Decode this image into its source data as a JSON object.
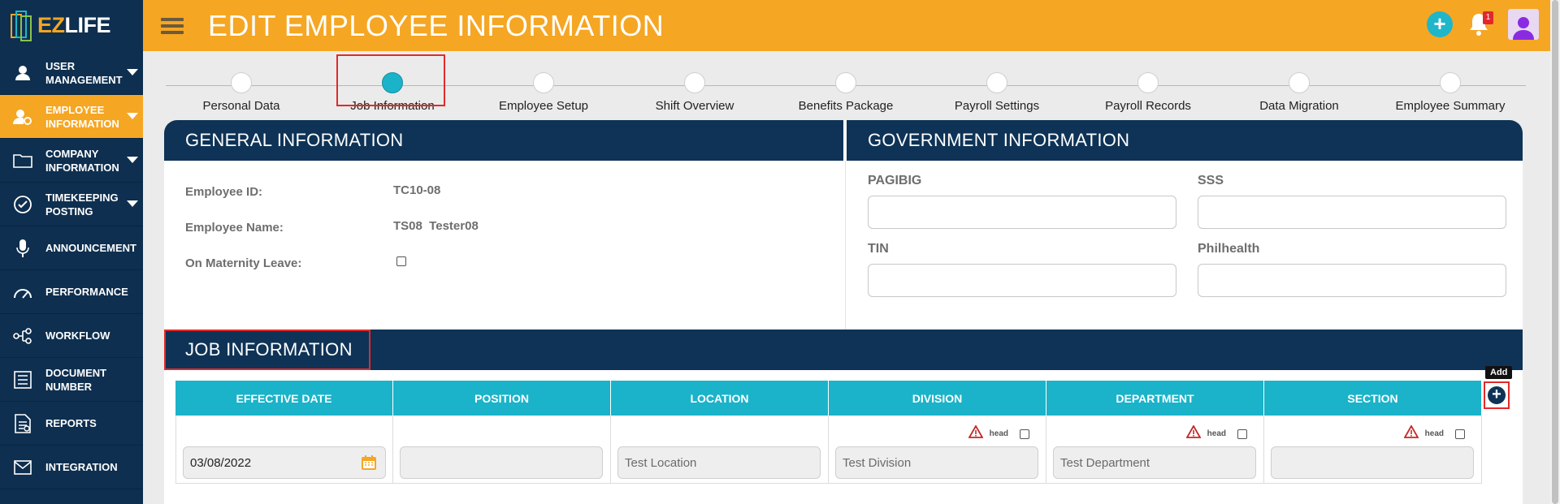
{
  "app": {
    "logo_prefix": "EZ",
    "logo_suffix": "LIFE"
  },
  "header": {
    "title": "EDIT EMPLOYEE INFORMATION",
    "notification_count": "1"
  },
  "sidebar": {
    "items": [
      {
        "label": "USER MANAGEMENT",
        "icon": "user-icon",
        "active": false,
        "has_caret": true
      },
      {
        "label": "EMPLOYEE INFORMATION",
        "icon": "employee-settings-icon",
        "active": true,
        "has_caret": true
      },
      {
        "label": "COMPANY INFORMATION",
        "icon": "folder-icon",
        "active": false,
        "has_caret": true
      },
      {
        "label": "TIMEKEEPING POSTING",
        "icon": "check-circle-icon",
        "active": false,
        "has_caret": true
      },
      {
        "label": "ANNOUNCEMENT",
        "icon": "microphone-icon",
        "active": false,
        "has_caret": false
      },
      {
        "label": "PERFORMANCE",
        "icon": "gauge-icon",
        "active": false,
        "has_caret": false
      },
      {
        "label": "WORKFLOW",
        "icon": "workflow-icon",
        "active": false,
        "has_caret": false
      },
      {
        "label": "DOCUMENT NUMBER",
        "icon": "document-list-icon",
        "active": false,
        "has_caret": false
      },
      {
        "label": "REPORTS",
        "icon": "report-icon",
        "active": false,
        "has_caret": false
      },
      {
        "label": "INTEGRATION",
        "icon": "mail-icon",
        "active": false,
        "has_caret": false
      }
    ]
  },
  "stepper": {
    "steps": [
      {
        "label": "Personal Data"
      },
      {
        "label": "Job Information"
      },
      {
        "label": "Employee Setup"
      },
      {
        "label": "Shift Overview"
      },
      {
        "label": "Benefits Package"
      },
      {
        "label": "Payroll Settings"
      },
      {
        "label": "Payroll Records"
      },
      {
        "label": "Data Migration"
      },
      {
        "label": "Employee Summary"
      }
    ],
    "active_index": 1
  },
  "general": {
    "title": "GENERAL INFORMATION",
    "employee_id_label": "Employee ID:",
    "employee_id": "TC10-08",
    "employee_name_label": "Employee Name:",
    "employee_name": "TS08  Tester08",
    "maternity_label": "On Maternity Leave:"
  },
  "government": {
    "title": "GOVERNMENT INFORMATION",
    "pagibig_label": "PAGIBIG",
    "sss_label": "SSS",
    "tin_label": "TIN",
    "philhealth_label": "Philhealth"
  },
  "job": {
    "title": "JOB INFORMATION",
    "columns": [
      "EFFECTIVE DATE",
      "POSITION",
      "LOCATION",
      "DIVISION",
      "DEPARTMENT",
      "SECTION"
    ],
    "row": {
      "effective_date": "03/08/2022",
      "position": "",
      "location": "Test Location",
      "division": "Test Division",
      "department": "Test Department",
      "section": ""
    },
    "head_label": "head",
    "add_tooltip": "Add"
  },
  "colors": {
    "accent_orange": "#f5a623",
    "navy": "#0e3356",
    "teal": "#1ab3c9",
    "highlight_red": "#e22a2a"
  }
}
